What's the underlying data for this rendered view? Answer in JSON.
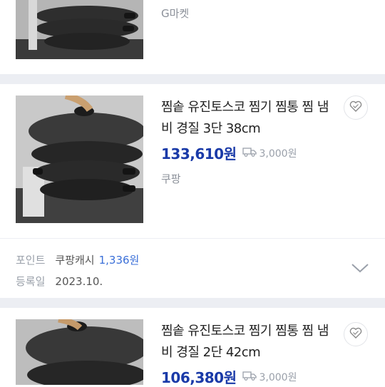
{
  "products": [
    {
      "mall": "G마켓"
    },
    {
      "title": "찜솥 유진토스코 찜기 찜통 찜 냄비 경질 3단 38cm",
      "price": "133,610원",
      "shipping": "3,000원",
      "mall": "쿠팡",
      "point_label": "포인트",
      "point_name": "쿠팡캐시",
      "point_value": "1,336원",
      "date_label": "등록일",
      "date_value": "2023.10."
    },
    {
      "title": "찜솥 유진토스코 찜기 찜통 찜 냄비 경질 2단 42cm",
      "price": "106,380원",
      "shipping": "3,000원"
    }
  ],
  "icons": {
    "wishlist": "heart-icon",
    "shipping": "truck-icon",
    "expand": "chevron-down-icon"
  },
  "colors": {
    "price": "#1a3aa8",
    "point_value": "#3a6fd8",
    "divider": "#eceef3"
  }
}
